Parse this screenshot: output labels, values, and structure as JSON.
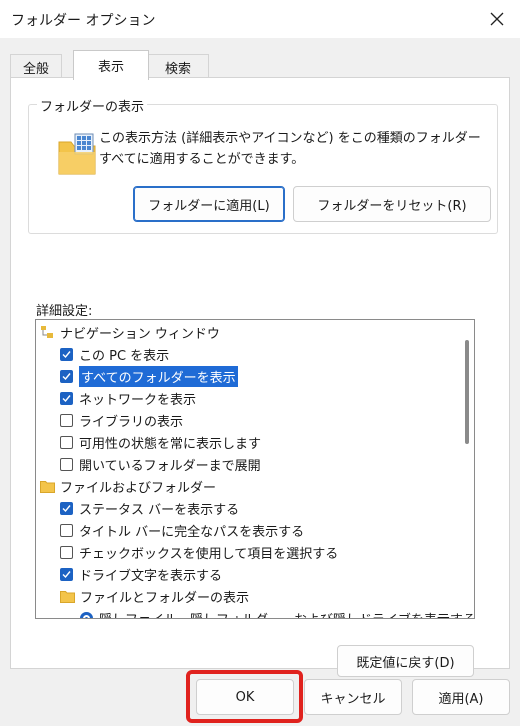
{
  "window": {
    "title": "フォルダー オプション"
  },
  "tabs": [
    {
      "label": "全般"
    },
    {
      "label": "表示"
    },
    {
      "label": "検索"
    }
  ],
  "folder_view": {
    "group_title": "フォルダーの表示",
    "description": "この表示方法 (詳細表示やアイコンなど) をこの種類のフォルダーすべてに適用することができます。",
    "apply_button": "フォルダーに適用(L)",
    "reset_button": "フォルダーをリセット(R)"
  },
  "advanced": {
    "label": "詳細設定:",
    "items": [
      {
        "kind": "folder",
        "label": "ナビゲーション ウィンドウ"
      },
      {
        "kind": "check",
        "checked": true,
        "label": "この PC を表示"
      },
      {
        "kind": "check",
        "checked": true,
        "selected": true,
        "label": "すべてのフォルダーを表示"
      },
      {
        "kind": "check",
        "checked": true,
        "label": "ネットワークを表示"
      },
      {
        "kind": "check",
        "checked": false,
        "label": "ライブラリの表示"
      },
      {
        "kind": "check",
        "checked": false,
        "label": "可用性の状態を常に表示します"
      },
      {
        "kind": "check",
        "checked": false,
        "label": "開いているフォルダーまで展開"
      },
      {
        "kind": "folder",
        "label": "ファイルおよびフォルダー"
      },
      {
        "kind": "check",
        "checked": true,
        "label": "ステータス バーを表示する"
      },
      {
        "kind": "check",
        "checked": false,
        "label": "タイトル バーに完全なパスを表示する"
      },
      {
        "kind": "check",
        "checked": false,
        "label": "チェックボックスを使用して項目を選択する"
      },
      {
        "kind": "check",
        "checked": true,
        "label": "ドライブ文字を表示する"
      },
      {
        "kind": "subfolder",
        "label": "ファイルとフォルダーの表示"
      },
      {
        "kind": "radio",
        "label": "隠しファイル、隠しフォルダー、および隠しドライブを表示する"
      }
    ],
    "restore_button": "既定値に戻す(D)"
  },
  "footer": {
    "ok": "OK",
    "cancel": "キャンセル",
    "apply": "適用(A)"
  }
}
